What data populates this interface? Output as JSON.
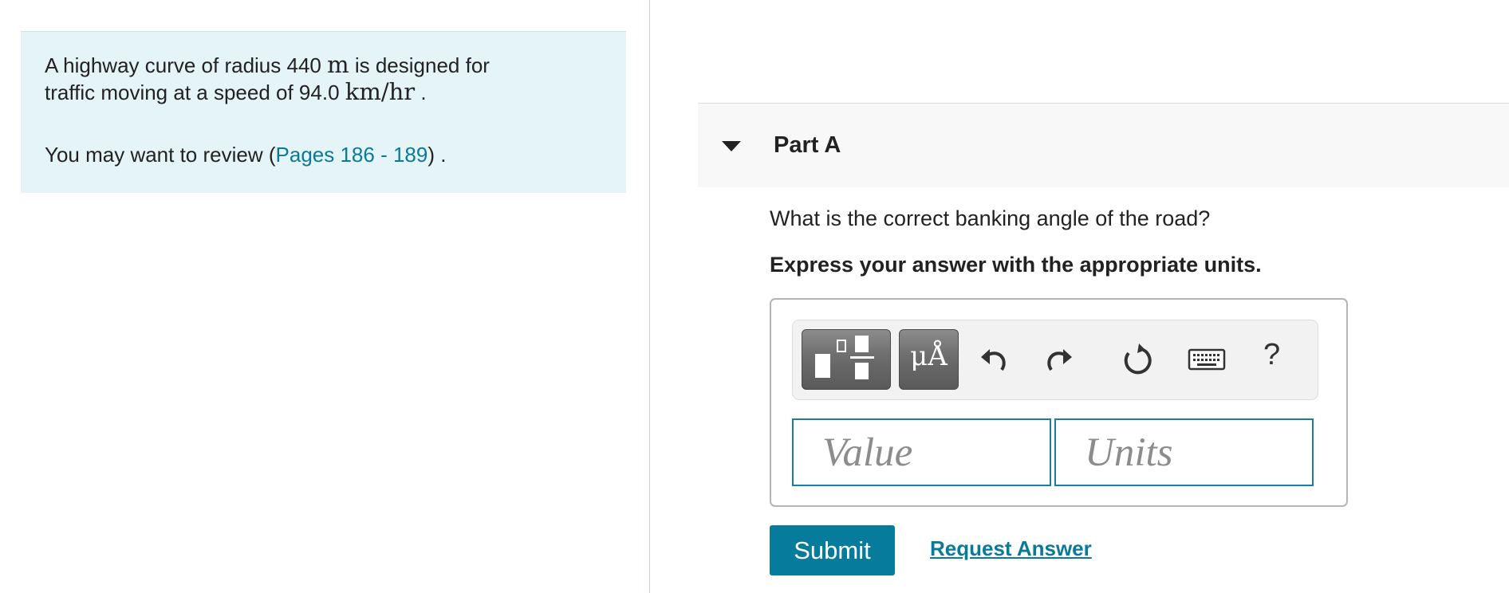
{
  "problem": {
    "line1_prefix": "A highway curve of radius 440 ",
    "line1_math": "m",
    "line1_suffix": " is designed for",
    "line2_prefix": "traffic moving at a speed of 94.0 ",
    "line2_math": "km/hr",
    "line2_suffix": " .",
    "review_prefix": "You may want to review (",
    "review_link": "Pages 186 - 189",
    "review_suffix": ") ."
  },
  "part": {
    "title": "Part A",
    "question": "What is the correct banking angle of the road?",
    "instruction": "Express your answer with the appropriate units."
  },
  "toolbar": {
    "units_glyph": "μÅ",
    "help_glyph": "?",
    "icons": [
      "templates-icon",
      "units-icon",
      "undo-icon",
      "redo-icon",
      "reset-icon",
      "keyboard-icon",
      "help-icon"
    ]
  },
  "answer": {
    "value_placeholder": "Value",
    "units_placeholder": "Units",
    "value": "",
    "units": ""
  },
  "actions": {
    "submit_label": "Submit",
    "request_answer_label": "Request Answer"
  },
  "colors": {
    "accent": "#067b9b",
    "link": "#0a7a99",
    "problem_bg": "#e5f4f6",
    "part_header_bg": "#f8f8f8",
    "toolbar_button": "#6d6d6d"
  }
}
